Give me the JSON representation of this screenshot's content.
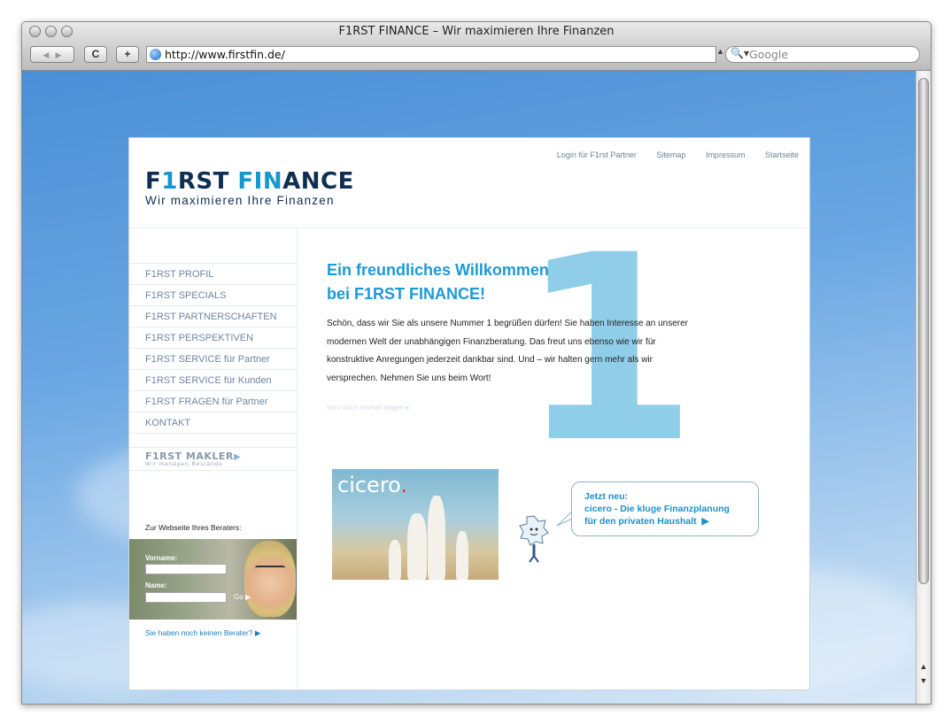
{
  "browser": {
    "title": "F1RST FINANCE – Wir maximieren Ihre Finanzen",
    "url": "http://www.firstfin.de/",
    "search_placeholder": "Google",
    "back_label": "◀",
    "forward_label": "▶",
    "reload_label": "C",
    "add_label": "+"
  },
  "header": {
    "top_links": [
      "Login für F1rst Partner",
      "Sitemap",
      "Impressum",
      "Startseite"
    ],
    "logo_part1": "F",
    "logo_one": "1",
    "logo_part2": "RST ",
    "logo_part3": "FIN",
    "logo_part4": "ANCE",
    "tagline": "Wir maximieren Ihre Finanzen"
  },
  "sidebar": {
    "items": [
      {
        "label": "F1RST PROFIL"
      },
      {
        "label": "F1RST SPECIALS"
      },
      {
        "label": "F1RST PARTNERSCHAFTEN"
      },
      {
        "label": "F1RST PERSPEKTIVEN"
      },
      {
        "label": "F1RST SERVICE für Partner"
      },
      {
        "label": "F1RST SERVICE für Kunden"
      },
      {
        "label": "F1RST FRAGEN für Partner"
      },
      {
        "label": "KONTAKT"
      }
    ],
    "makler_logo": "F1RST MAKLER",
    "makler_sub": "Wir managen Bestände",
    "berater_label": "Zur Webseite Ihres Beraters:",
    "vorname_label": "Vorname:",
    "name_label": "Name:",
    "go_label": "Go",
    "no_berater_link": "Sie haben noch keinen Berater?"
  },
  "main": {
    "welcome_line1": "Ein freundliches Willkommen",
    "welcome_line2": "bei F1RST FINANCE!",
    "intro": "Schön, dass wir Sie als unsere Nummer 1 begrüßen dürfen! Sie haben Interesse an unserer modernen Welt der unabhängigen Finanzberatung. Das freut uns ebenso wie wir für konstruktive Anregungen jederzeit dankbar sind. Und – wir halten gern mehr als wir versprechen. Nehmen Sie uns beim Wort!",
    "intro_again": "Intro noch einmal zeigen",
    "big_numeral": "1",
    "cicero_logo": "cicero",
    "bubble_line1": "Jetzt neu:",
    "bubble_line2": "cicero - Die kluge Finanzplanung",
    "bubble_line3": "für den privaten Haushalt"
  }
}
